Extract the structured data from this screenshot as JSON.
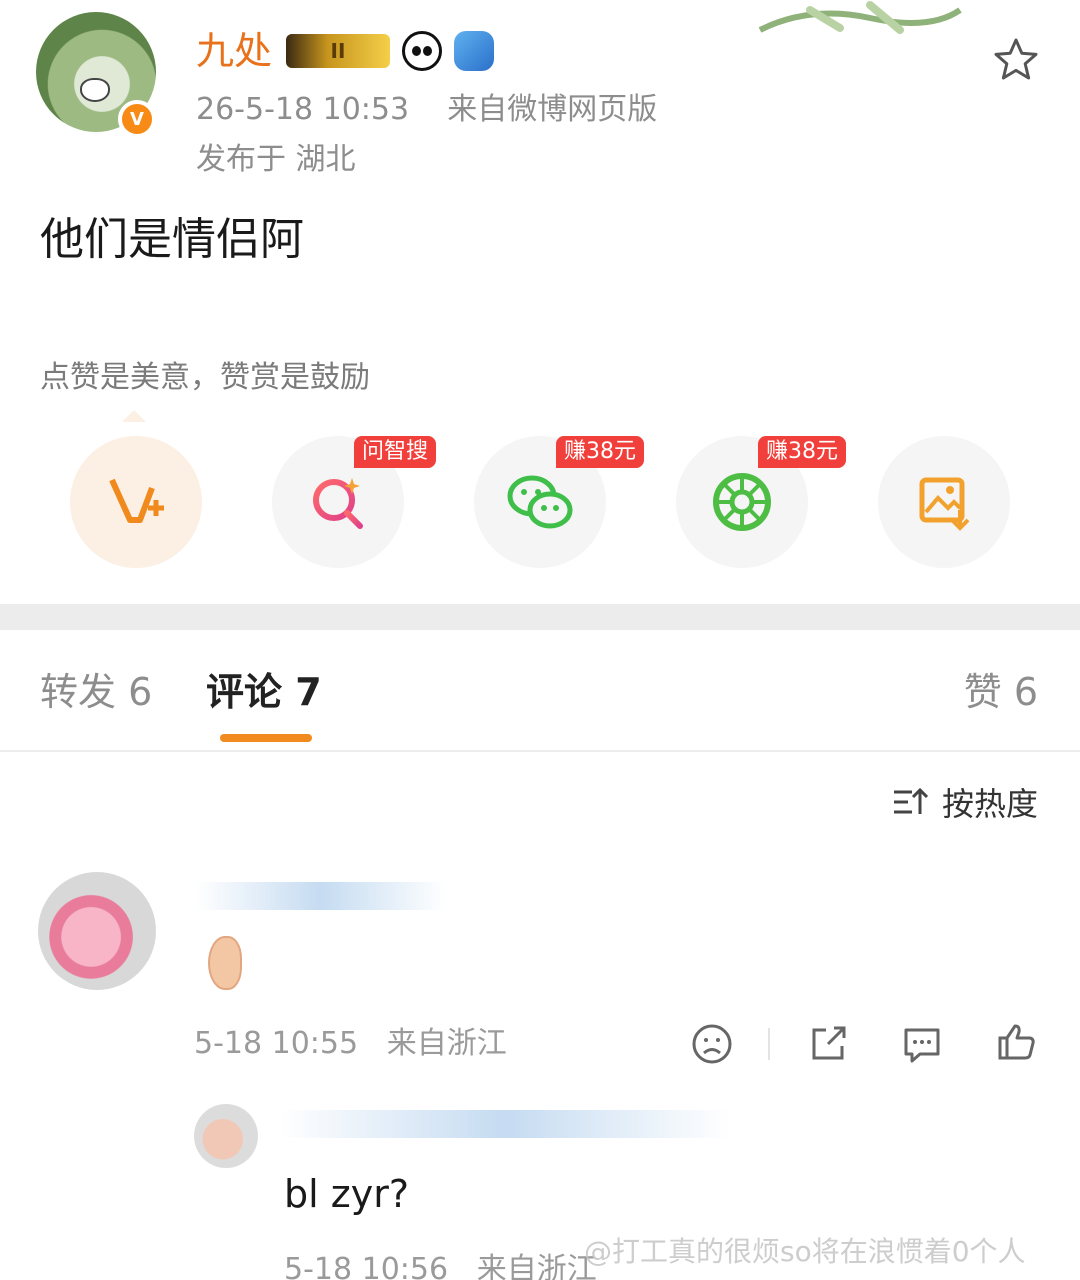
{
  "post": {
    "username": "九处",
    "level_badge": "II",
    "verified_mark": "V",
    "time": "26-5-18 10:53",
    "source": "来自微博网页版",
    "location_label": "发布于 湖北",
    "text": "他们是情侣阿",
    "reward_tip": "点赞是美意，赞赏是鼓励"
  },
  "actions": [
    {
      "name": "vplus",
      "icon": "v-plus-icon",
      "tag": ""
    },
    {
      "name": "search",
      "icon": "ai-search-icon",
      "tag": "问智搜"
    },
    {
      "name": "wechat",
      "icon": "wechat-icon",
      "tag": "赚38元"
    },
    {
      "name": "moments",
      "icon": "moments-icon",
      "tag": "赚38元"
    },
    {
      "name": "save-image",
      "icon": "save-image-icon",
      "tag": ""
    }
  ],
  "tabs": {
    "repost": "转发 6",
    "comments": "评论 7",
    "likes": "赞 6"
  },
  "sort_label": "按热度",
  "comments": [
    {
      "text": "",
      "time": "5-18 10:55",
      "source": "来自浙江"
    },
    {
      "text": "bl zyr?",
      "time": "5-18 10:56",
      "source": "来自浙江"
    }
  ],
  "watermark": "@打工真的很烦so将在浪惯着0个人",
  "colors": {
    "username": "#e8721b",
    "accent": "#f28b1f",
    "tag_red": "#f1403c",
    "meta_gray": "#8d8d8d"
  }
}
